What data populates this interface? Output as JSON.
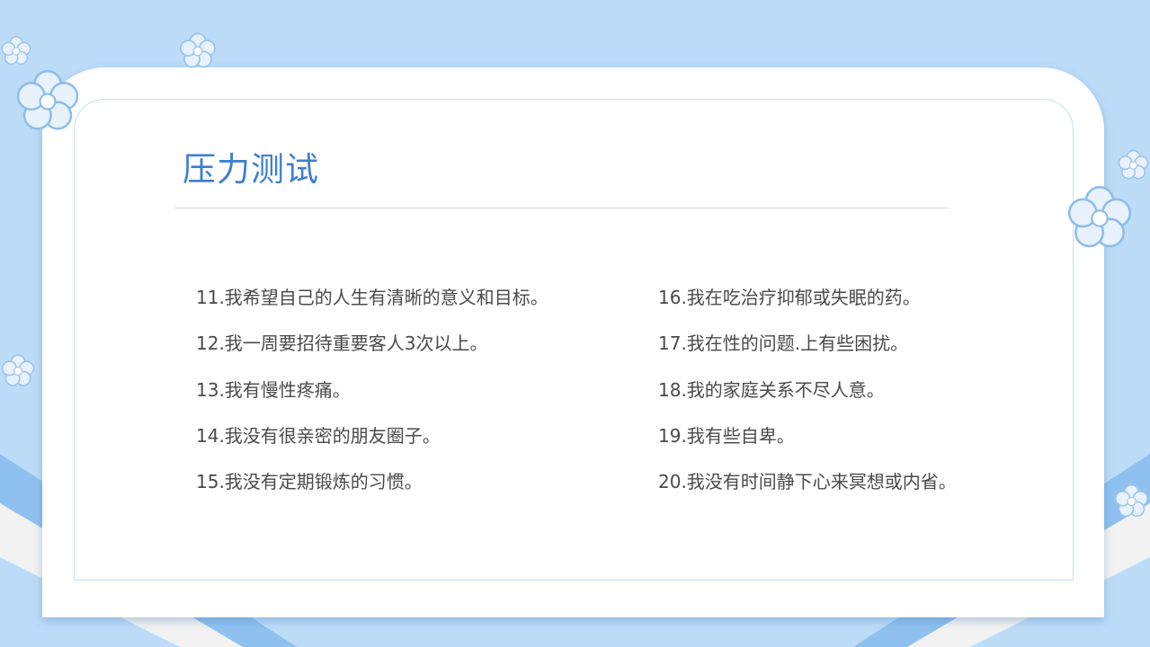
{
  "slide": {
    "title": "压力测试",
    "left_items": [
      "11.我希望自己的人生有清晰的意义和目标。",
      "12.我一周要招待重要客人3次以上。",
      "13.我有慢性疼痛。",
      "14.我没有很亲密的朋友圈子。",
      "15.我没有定期锻炼的习惯。"
    ],
    "right_items": [
      "16.我在吃治疗抑郁或失眠的药。",
      "17.我在性的问题.上有些困扰。",
      "18.我的家庭关系不尽人意。",
      "19.我有些自卑。",
      "20.我没有时间静下心来冥想或内省。"
    ]
  },
  "colors": {
    "background": "#bcdcf8",
    "title": "#3d7fd0",
    "text": "#4a4a4a",
    "stripe_blue": "#8ec1f0",
    "stripe_white": "#f2f2f2"
  },
  "decorations": {
    "icon": "flower-icon"
  }
}
